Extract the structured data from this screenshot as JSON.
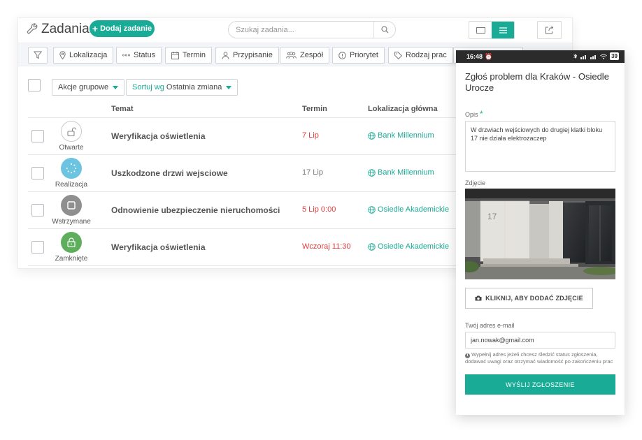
{
  "header": {
    "title": "Zadania",
    "add_button": "Dodaj zadanie",
    "search_placeholder": "Szukaj zadania..."
  },
  "filters": [
    "Lokalizacja",
    "Status",
    "Termin",
    "Przypisanie",
    "Zespół",
    "Priorytet",
    "Rodzaj prac"
  ],
  "bulk": {
    "actions_label": "Akcje grupowe",
    "sort_prefix": "Sortuj wg",
    "sort_value": "Ostatnia zmiana"
  },
  "table": {
    "columns": {
      "topic": "Temat",
      "due": "Termin",
      "location": "Lokalizacja główna"
    },
    "rows": [
      {
        "status": "Otwarte",
        "topic": "Weryfikacja oświetlenia",
        "due": "7 Lip",
        "location": "Bank Millennium"
      },
      {
        "status": "Realizacja",
        "topic": "Uszkodzone drzwi wejsciowe",
        "due": "17 Lip",
        "location": "Bank Millennium"
      },
      {
        "status": "Wstrzymane",
        "topic": "Odnowienie ubezpieczenie nieruchomości",
        "due": "5 Lip 0:00",
        "location": "Osiedle Akademickie"
      },
      {
        "status": "Zamknięte",
        "topic": "Weryfikacja oświetlenia",
        "due": "Wczoraj 11:30",
        "location": "Osiedle Akademickie"
      }
    ]
  },
  "colors": {
    "accent": "#1aab96",
    "overdue": "#e23b3b",
    "status_progress": "#6cc4e0",
    "status_paused": "#8f8f8f",
    "status_closed": "#5fae5d"
  },
  "mobile": {
    "status_time": "16:48",
    "battery": "39",
    "title": "Zgłoś problem dla Kraków - Osiedle Urocze",
    "description_label": "Opis",
    "description_value": "W drzwiach wejściowych do drugiej klatki bloku 17 nie działa elektrozaczep",
    "photo_label": "Zdjęcie",
    "photo_number": "17",
    "add_photo_button": "KLIKNIJ, ABY DODAĆ ZDJĘCIE",
    "email_label": "Twój adres e-mail",
    "email_value": "jan.nowak@gmail.com",
    "hint": "Wypełnij adres jeżeli chcesz śledzić status zgłoszenia, dodawać uwagi oraz otrzymać wiadomość po zakończeniu prac",
    "submit_button": "WYŚLIJ ZGŁOSZENIE"
  }
}
